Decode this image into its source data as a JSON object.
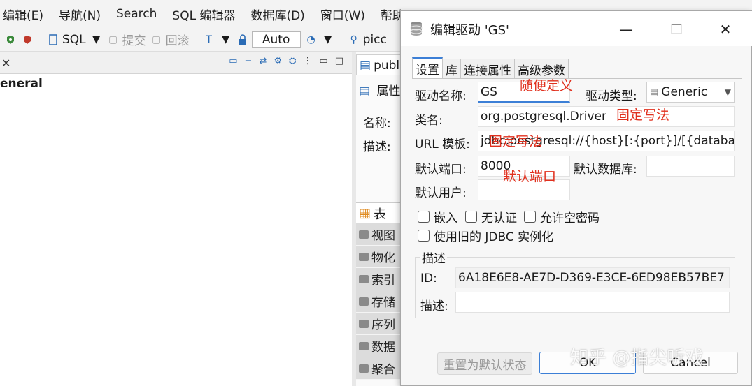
{
  "menubar": {
    "items": [
      "编辑(E)",
      "导航(N)",
      "Search",
      "SQL 编辑器",
      "数据库(D)",
      "窗口(W)",
      "帮助(H)"
    ]
  },
  "toolbar": {
    "sql_label": "SQL",
    "commit_label": "提交",
    "rollback_label": "回滚",
    "auto_label": "Auto",
    "picc_label": "picc"
  },
  "left_panel": {
    "general_label": "eneral"
  },
  "mid_panel": {
    "tab_label": "publ",
    "props_label": "属性",
    "name_label": "名称:",
    "desc_label": "描述:",
    "table_label": "表",
    "rows": [
      "视图",
      "物化",
      "索引",
      "存储",
      "序列",
      "数据",
      "聚合"
    ]
  },
  "dialog": {
    "title": "编辑驱动 'GS'",
    "tabs": [
      "设置",
      "库",
      "连接属性",
      "高级参数"
    ],
    "driver_name_label": "驱动名称:",
    "driver_name_value": "GS",
    "driver_type_label": "驱动类型:",
    "driver_type_value": "Generic",
    "class_label": "类名:",
    "class_value": "org.postgresql.Driver",
    "url_label": "URL 模板:",
    "url_value": "jdbc:postgresql://{host}[:{port}]/[{database}]",
    "port_label": "默认端口:",
    "port_value": "8000",
    "default_db_label": "默认数据库:",
    "default_db_value": "",
    "default_user_label": "默认用户:",
    "default_user_value": "",
    "checkboxes": {
      "embedded": "嵌入",
      "no_auth": "无认证",
      "allow_empty_pw": "允许空密码",
      "legacy_jdbc": "使用旧的 JDBC 实例化"
    },
    "desc_group_title": "描述",
    "id_label": "ID:",
    "id_value": "6A18E6E8-AE7D-D369-E3CE-6ED98EB57BE7",
    "desc_label": "描述:",
    "desc_value": "",
    "buttons": {
      "reset": "重置为默认状态",
      "ok": "OK",
      "cancel": "Cancel"
    }
  },
  "annotations": {
    "name": "随便定义",
    "class": "固定写法",
    "url": "固定写法",
    "port": "默认端口"
  },
  "watermark": "知乎 @指尖听戏",
  "colors": {
    "accent": "#3c7fd6",
    "annotation": "#e0301e"
  }
}
